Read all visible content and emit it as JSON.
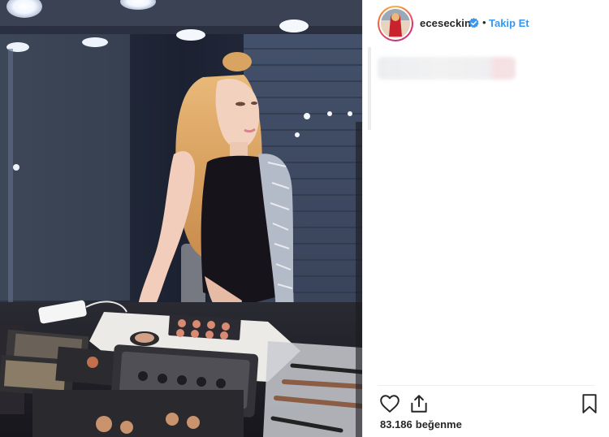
{
  "post": {
    "username": "eceseckin",
    "follow_label": "Takip Et",
    "separator": "•",
    "likes_count": "83.186",
    "likes_label": "beğenme"
  },
  "icons": {
    "verified": "verified-badge-icon",
    "like": "heart-icon",
    "share": "share-icon",
    "save": "bookmark-icon"
  },
  "colors": {
    "link": "#3897f0",
    "text": "#262626",
    "verified": "#3897f0"
  }
}
